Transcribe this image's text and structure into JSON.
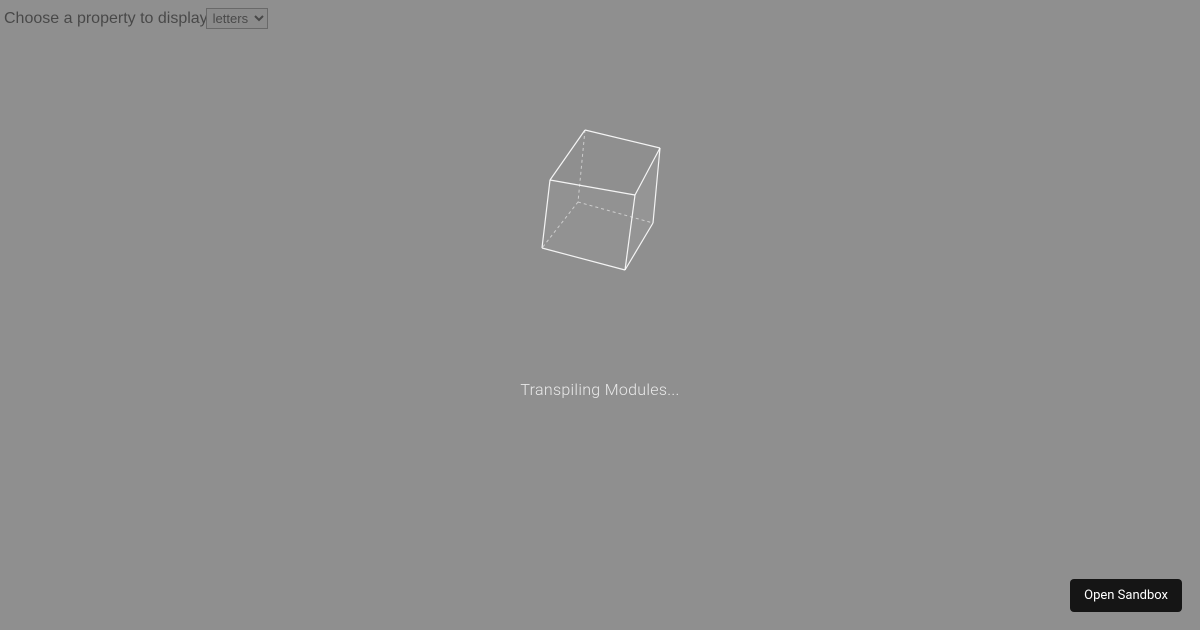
{
  "controls": {
    "property_label": "Choose a property to display",
    "property_selected": "letters"
  },
  "overlay": {
    "status_text": "Transpiling Modules...",
    "icon_name": "cube-wireframe"
  },
  "footer": {
    "open_sandbox_label": "Open Sandbox"
  }
}
